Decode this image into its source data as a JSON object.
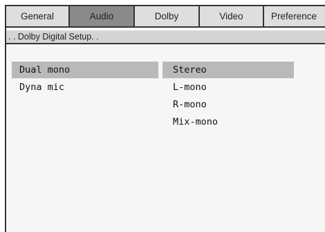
{
  "tabs": [
    {
      "label": "General",
      "active": false
    },
    {
      "label": "Audio",
      "active": true
    },
    {
      "label": "Dolby",
      "active": false
    },
    {
      "label": "Video",
      "active": false
    },
    {
      "label": "Preference",
      "active": false
    }
  ],
  "subtitle": ". . Dolby Digital Setup. .",
  "left_menu": {
    "items": [
      {
        "label": "Dual mono",
        "selected": true
      },
      {
        "label": "Dyna mic",
        "selected": false
      }
    ]
  },
  "right_menu": {
    "items": [
      {
        "label": "Stereo",
        "selected": true
      },
      {
        "label": "L-mono",
        "selected": false
      },
      {
        "label": "R-mono",
        "selected": false
      },
      {
        "label": "Mix-mono",
        "selected": false
      }
    ]
  },
  "colors": {
    "tab_inactive": "#dedede",
    "tab_active": "#8a8a8a",
    "highlight": "#b9b9b9",
    "content_bg": "#f6f6f6"
  }
}
